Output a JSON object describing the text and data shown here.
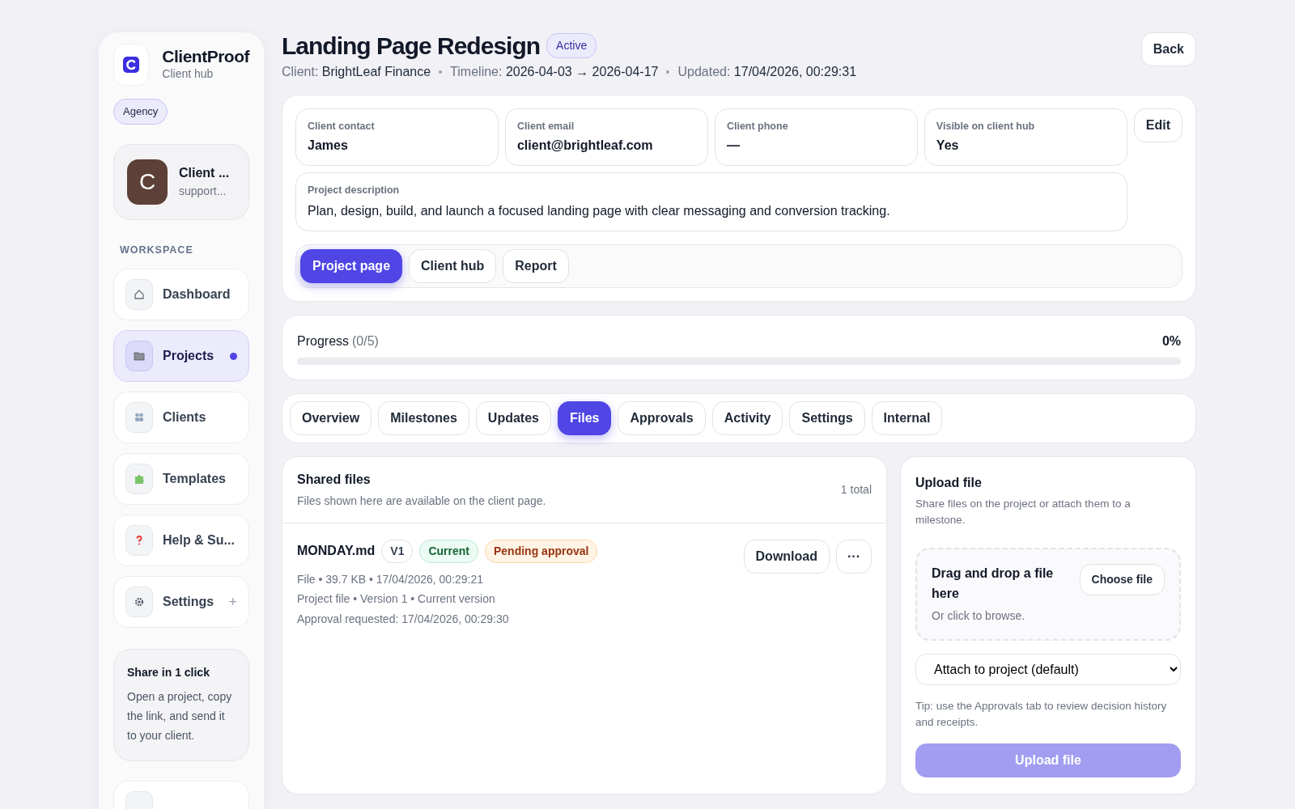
{
  "brand": {
    "name": "ClientProof",
    "subtitle": "Client hub",
    "plan": "Agency"
  },
  "account": {
    "initial": "C",
    "name": "Client ...",
    "email": "support..."
  },
  "sidebar": {
    "section": "WORKSPACE",
    "items": [
      {
        "label": "Dashboard",
        "selected": false
      },
      {
        "label": "Projects",
        "selected": true
      },
      {
        "label": "Clients",
        "selected": false
      },
      {
        "label": "Templates",
        "selected": false
      },
      {
        "label": "Help & Su...",
        "selected": false
      },
      {
        "label": "Settings",
        "selected": false,
        "extra": "+"
      }
    ],
    "promo": {
      "title": "Share in 1 click",
      "text": "Open a project, copy the link, and send it to your client."
    }
  },
  "header": {
    "title": "Landing Page Redesign",
    "status": "Active",
    "back": "Back",
    "meta": [
      {
        "label": "Client:",
        "value": "BrightLeaf Finance"
      },
      {
        "label": "Timeline:",
        "value": "2026-04-03 → 2026-04-17"
      },
      {
        "label": "Updated:",
        "value": "17/04/2026, 00:29:31"
      }
    ]
  },
  "details": {
    "fields": [
      {
        "label": "Client contact",
        "value": "James"
      },
      {
        "label": "Client email",
        "value": "client@brightleaf.com"
      },
      {
        "label": "Client phone",
        "value": "—"
      },
      {
        "label": "Visible on client hub",
        "value": "Yes"
      }
    ],
    "edit": "Edit",
    "description": {
      "label": "Project description",
      "value": "Plan, design, build, and launch a focused landing page with clear messaging and conversion tracking."
    },
    "views": [
      {
        "label": "Project page",
        "selected": true
      },
      {
        "label": "Client hub",
        "selected": false
      },
      {
        "label": "Report",
        "selected": false
      }
    ]
  },
  "progress": {
    "label": "Progress",
    "count": "(0/5)",
    "reading": "0%",
    "level": 0
  },
  "tabs": [
    {
      "label": "Overview",
      "selected": false
    },
    {
      "label": "Milestones",
      "selected": false
    },
    {
      "label": "Updates",
      "selected": false
    },
    {
      "label": "Files",
      "selected": true
    },
    {
      "label": "Approvals",
      "selected": false
    },
    {
      "label": "Activity",
      "selected": false
    },
    {
      "label": "Settings",
      "selected": false
    },
    {
      "label": "Internal",
      "selected": false
    }
  ],
  "files": {
    "title": "Shared files",
    "subtitle": "Files shown here are available on the client page.",
    "total": "1 total",
    "items": [
      {
        "name": "MONDAY.md",
        "version": "V1",
        "badges": [
          {
            "label": "Current",
            "kind": "success"
          },
          {
            "label": "Pending approval",
            "kind": "warning"
          }
        ],
        "lines": [
          "File • 39.7 KB • 17/04/2026, 00:29:21",
          "Project file • Version 1 • Current version",
          "Approval requested: 17/04/2026, 00:29:30"
        ],
        "download": "Download",
        "more": "···"
      }
    ]
  },
  "upload": {
    "title": "Upload file",
    "subtitle": "Share files on the project or attach them to a milestone.",
    "drop_title": "Drag and drop a file here",
    "drop_hint": "Or click to browse.",
    "choose": "Choose file",
    "attach": "Attach to project (default)",
    "tip": "Tip: use the Approvals tab to review decision history and receipts.",
    "button": "Upload file",
    "disabled": true
  }
}
